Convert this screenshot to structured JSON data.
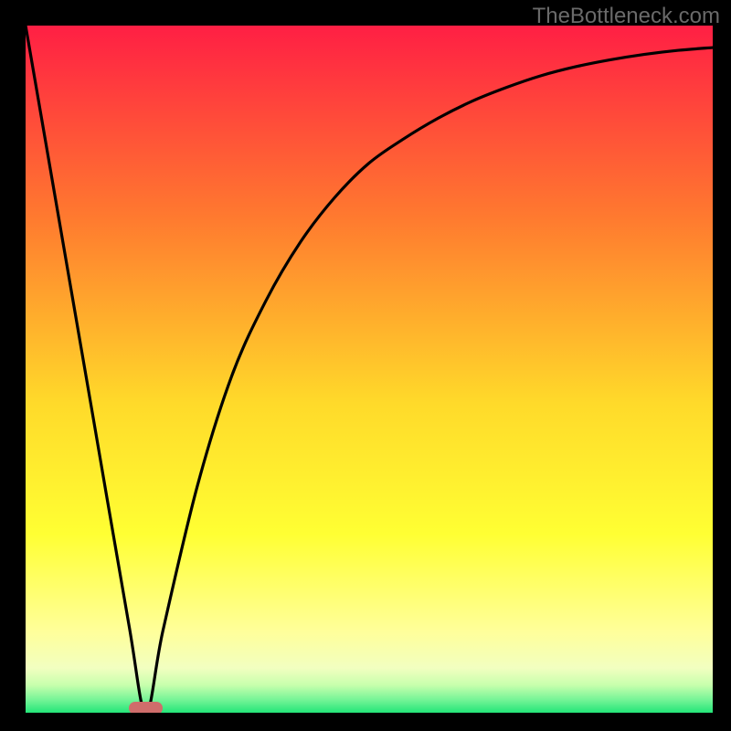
{
  "watermark": "TheBottleneck.com",
  "colors": {
    "top": "#ff1f44",
    "mid1": "#ff7a2f",
    "mid2": "#ffda2a",
    "mid3": "#ffff66",
    "pale": "#f7ffb8",
    "green": "#23e679",
    "curve": "#000000",
    "marker": "#cf6d6b",
    "frame": "#000000"
  },
  "chart_data": {
    "type": "line",
    "title": "",
    "xlabel": "",
    "ylabel": "",
    "xlim": [
      0,
      100
    ],
    "ylim": [
      0,
      100
    ],
    "series": [
      {
        "name": "bottleneck-curve",
        "x": [
          0,
          5,
          10,
          15,
          17.5,
          20,
          25,
          30,
          35,
          40,
          45,
          50,
          55,
          60,
          65,
          70,
          75,
          80,
          85,
          90,
          95,
          100
        ],
        "values": [
          100,
          71,
          42,
          13,
          0,
          12,
          33,
          49,
          60,
          68.5,
          75,
          80,
          83.5,
          86.5,
          89,
          91,
          92.7,
          94,
          95,
          95.8,
          96.4,
          96.8
        ]
      }
    ],
    "marker": {
      "x_start": 15,
      "x_end": 20,
      "y": 0
    },
    "annotations": []
  }
}
